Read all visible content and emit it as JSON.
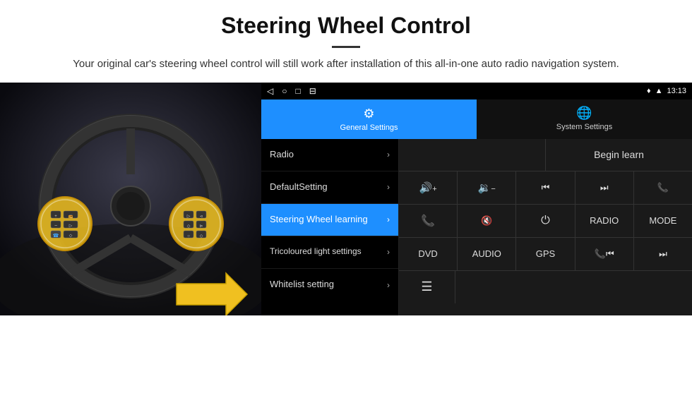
{
  "header": {
    "title": "Steering Wheel Control",
    "subtitle": "Your original car's steering wheel control will still work after installation of this all-in-one auto radio navigation system."
  },
  "status_bar": {
    "time": "13:13",
    "icons_left": [
      "◁",
      "○",
      "□",
      "⊟"
    ],
    "icons_right": [
      "♥",
      "▲"
    ]
  },
  "nav_tabs": [
    {
      "id": "general",
      "label": "General Settings",
      "icon": "⚙",
      "active": true
    },
    {
      "id": "system",
      "label": "System Settings",
      "icon": "🌐",
      "active": false
    }
  ],
  "menu_items": [
    {
      "id": "radio",
      "label": "Radio",
      "active": false
    },
    {
      "id": "default",
      "label": "DefaultSetting",
      "active": false
    },
    {
      "id": "steering",
      "label": "Steering Wheel learning",
      "active": true
    },
    {
      "id": "tricolour",
      "label": "Tricoloured light settings",
      "active": false
    },
    {
      "id": "whitelist",
      "label": "Whitelist setting",
      "active": false
    }
  ],
  "begin_learn_label": "Begin learn",
  "button_grid": {
    "row1": [
      {
        "id": "vol-up",
        "content": "🔊+",
        "type": "icon"
      },
      {
        "id": "vol-down",
        "content": "🔉-",
        "type": "icon"
      },
      {
        "id": "prev-track",
        "content": "⏮",
        "type": "icon"
      },
      {
        "id": "next-track",
        "content": "⏭",
        "type": "icon"
      },
      {
        "id": "phone",
        "content": "📞",
        "type": "icon"
      }
    ],
    "row2": [
      {
        "id": "call-accept",
        "content": "📞",
        "type": "icon"
      },
      {
        "id": "mute",
        "content": "🔇",
        "type": "icon"
      },
      {
        "id": "power",
        "content": "⏻",
        "type": "icon"
      },
      {
        "id": "radio-btn",
        "content": "RADIO",
        "type": "text"
      },
      {
        "id": "mode",
        "content": "MODE",
        "type": "text"
      }
    ]
  },
  "bottom_row": [
    {
      "id": "dvd",
      "content": "DVD"
    },
    {
      "id": "audio",
      "content": "AUDIO"
    },
    {
      "id": "gps",
      "content": "GPS"
    },
    {
      "id": "tel-prev",
      "content": "📞⏮"
    },
    {
      "id": "skip-next",
      "content": "⏭"
    }
  ],
  "icon_row": {
    "icon": "☰"
  }
}
